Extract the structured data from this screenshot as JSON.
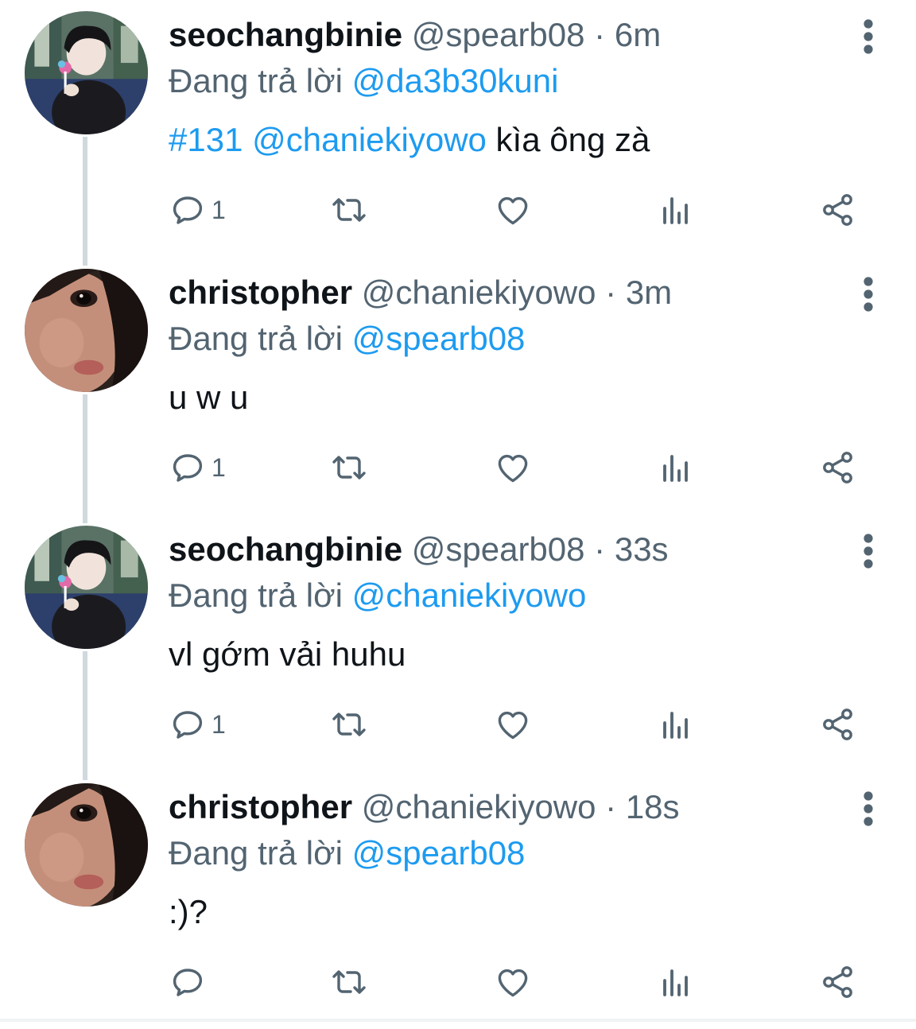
{
  "tweets": [
    {
      "display_name": "seochangbinie",
      "handle": "@spearb08",
      "separator": " · ",
      "time": "6m",
      "replying_label": "Đang trả lời ",
      "replying_to": "@da3b30kuni",
      "body_hashtag": "#131",
      "body_mention": "@chaniekiyowo",
      "body_text": " kìa ông zà",
      "reply_count": "1",
      "avatar": "avatar-seochangbinie"
    },
    {
      "display_name": "christopher",
      "handle": "@chaniekiyowo",
      "separator": " · ",
      "time": "3m",
      "replying_label": "Đang trả lời ",
      "replying_to": "@spearb08",
      "body_hashtag": "",
      "body_mention": "",
      "body_text": "u w u",
      "reply_count": "1",
      "avatar": "avatar-christopher"
    },
    {
      "display_name": "seochangbinie",
      "handle": "@spearb08",
      "separator": " · ",
      "time": "33s",
      "replying_label": "Đang trả lời ",
      "replying_to": "@chaniekiyowo",
      "body_hashtag": "",
      "body_mention": "",
      "body_text": "vl gớm vải huhu",
      "reply_count": "1",
      "avatar": "avatar-seochangbinie"
    },
    {
      "display_name": "christopher",
      "handle": "@chaniekiyowo",
      "separator": " · ",
      "time": "18s",
      "replying_label": "Đang trả lời ",
      "replying_to": "@spearb08",
      "body_hashtag": "",
      "body_mention": "",
      "body_text": ":)?",
      "reply_count": "",
      "avatar": "avatar-christopher"
    }
  ],
  "icons": {
    "reply": "reply-icon",
    "retweet": "retweet-icon",
    "like": "heart-icon",
    "views": "views-chart-icon",
    "share": "share-icon",
    "more": "more-vertical-icon"
  },
  "colors": {
    "link": "#1d9bf0",
    "secondary_text": "#536471",
    "primary_text": "#0f1419",
    "connector": "#cfd9de"
  }
}
